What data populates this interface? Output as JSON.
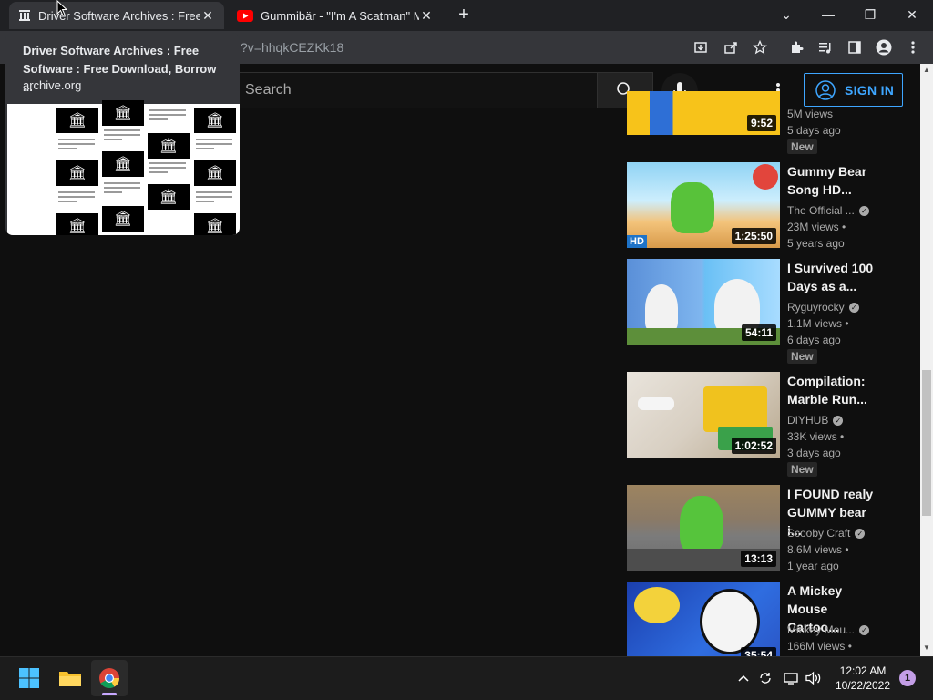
{
  "browser": {
    "tabs": [
      {
        "title": "Driver Software Archives : Free Software",
        "close": "✕"
      },
      {
        "title": "Gummibär - \"I'm A Scatman\" Music Video",
        "close": "✕"
      }
    ],
    "new_tab": "+",
    "window_controls": {
      "menu": "⌄",
      "minimize": "—",
      "restore": "❐",
      "close": "✕"
    },
    "address": "?v=hhqkCEZKk18"
  },
  "hover_card": {
    "title": "Driver Software Archives : Free Software : Free Download, Borrow ...",
    "domain": "archive.org"
  },
  "youtube": {
    "search_placeholder": "Search",
    "sign_in": "SIGN IN",
    "videos": [
      {
        "title": "",
        "duration": "9:52",
        "channel": "",
        "views": "5M views",
        "age": "5 days ago",
        "badge": "New"
      },
      {
        "title": "Gummy Bear Song HD...",
        "duration": "1:25:50",
        "channel": "The Official ...",
        "views": "23M views",
        "age": "5 years ago",
        "hd": "HD"
      },
      {
        "title": "I Survived 100 Days as a...",
        "duration": "54:11",
        "channel": "Ryguyrocky",
        "views": "1.1M views",
        "age": "6 days ago",
        "badge": "New"
      },
      {
        "title": "Compilation: Marble Run...",
        "duration": "1:02:52",
        "channel": "DIYHUB",
        "views": "33K views",
        "age": "3 days ago",
        "badge": "New"
      },
      {
        "title": "I FOUND realy GUMMY bear i...",
        "duration": "13:13",
        "channel": "Scooby Craft",
        "views": "8.6M views",
        "age": "1 year ago"
      },
      {
        "title": "A Mickey Mouse Cartoo...",
        "duration": "35:54",
        "channel": "Mickey Mou...",
        "views": "166M views",
        "age": ""
      }
    ]
  },
  "taskbar": {
    "time": "12:02 AM",
    "date": "10/22/2022",
    "notifications": "1"
  }
}
